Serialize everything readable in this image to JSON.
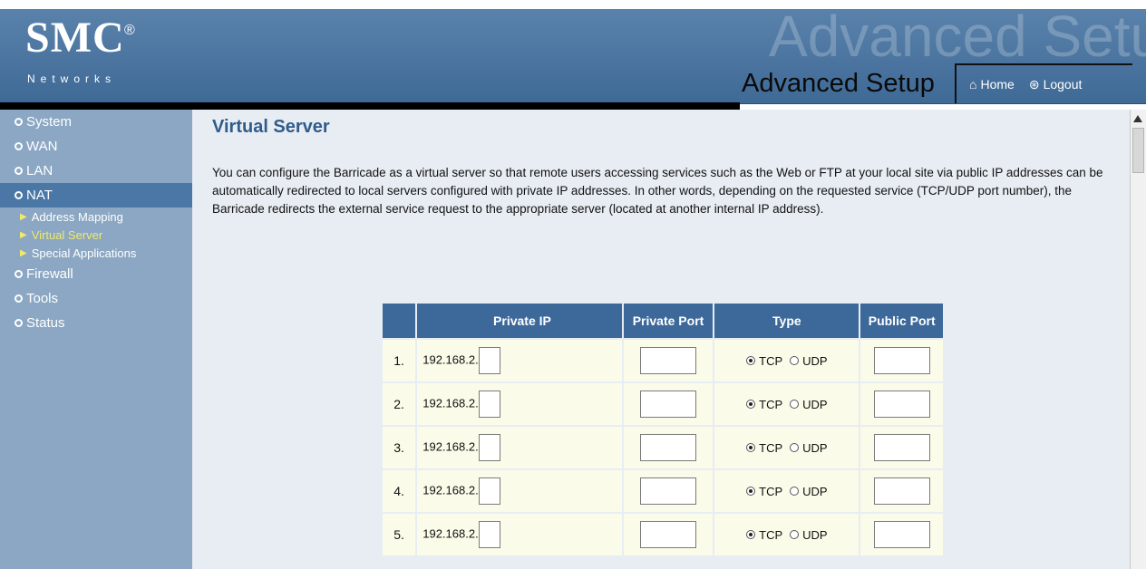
{
  "header": {
    "logo": "SMC",
    "logo_mark": "®",
    "logo_sub": "Networks",
    "watermark": "Advanced Setup",
    "title": "Advanced Setup",
    "home_label": "Home",
    "home_icon": "home-icon",
    "logout_label": "Logout",
    "logout_icon": "logout-icon"
  },
  "sidebar": {
    "items": [
      {
        "label": "System",
        "icon": "bullet-circle-icon"
      },
      {
        "label": "WAN",
        "icon": "bullet-circle-icon"
      },
      {
        "label": "LAN",
        "icon": "bullet-circle-icon"
      },
      {
        "label": "NAT",
        "icon": "bullet-circle-icon",
        "active": true
      },
      {
        "label": "Firewall",
        "icon": "bullet-circle-icon"
      },
      {
        "label": "Tools",
        "icon": "bullet-circle-icon"
      },
      {
        "label": "Status",
        "icon": "bullet-circle-icon"
      }
    ],
    "nat_subitems": [
      {
        "label": "Address Mapping",
        "icon": "arrow-right-icon"
      },
      {
        "label": "Virtual Server",
        "icon": "arrow-right-icon",
        "current": true
      },
      {
        "label": "Special Applications",
        "icon": "arrow-right-icon"
      }
    ]
  },
  "main": {
    "title": "Virtual Server",
    "description": "You can configure the Barricade as a virtual server so that remote users accessing services such as the Web or FTP at your local site via public IP addresses can be automatically redirected to local servers configured with private IP addresses. In other words, depending on the requested service (TCP/UDP port number), the Barricade redirects the external service request to the appropriate server (located at another internal IP address).",
    "table": {
      "headers": [
        "",
        "Private IP",
        "Private Port",
        "Type",
        "Public Port"
      ],
      "rows": [
        {
          "num": "1.",
          "ip_prefix": "192.168.2.",
          "ip_value": "",
          "private_port": "",
          "type_selected": "TCP",
          "public_port": ""
        },
        {
          "num": "2.",
          "ip_prefix": "192.168.2.",
          "ip_value": "",
          "private_port": "",
          "type_selected": "TCP",
          "public_port": ""
        },
        {
          "num": "3.",
          "ip_prefix": "192.168.2.",
          "ip_value": "",
          "private_port": "",
          "type_selected": "TCP",
          "public_port": ""
        },
        {
          "num": "4.",
          "ip_prefix": "192.168.2.",
          "ip_value": "",
          "private_port": "",
          "type_selected": "TCP",
          "public_port": ""
        },
        {
          "num": "5.",
          "ip_prefix": "192.168.2.",
          "ip_value": "",
          "private_port": "",
          "type_selected": "TCP",
          "public_port": ""
        }
      ],
      "type_options": [
        "TCP",
        "UDP"
      ]
    }
  },
  "colors": {
    "header_bg": "#4f77a1",
    "sidebar_bg": "#8ba7c3",
    "sidebar_active": "#4a77a6",
    "current_subitem": "#f1e96b",
    "title_blue": "#2f5c8c",
    "table_header": "#3c689a",
    "table_cell": "#fbfbe9"
  }
}
